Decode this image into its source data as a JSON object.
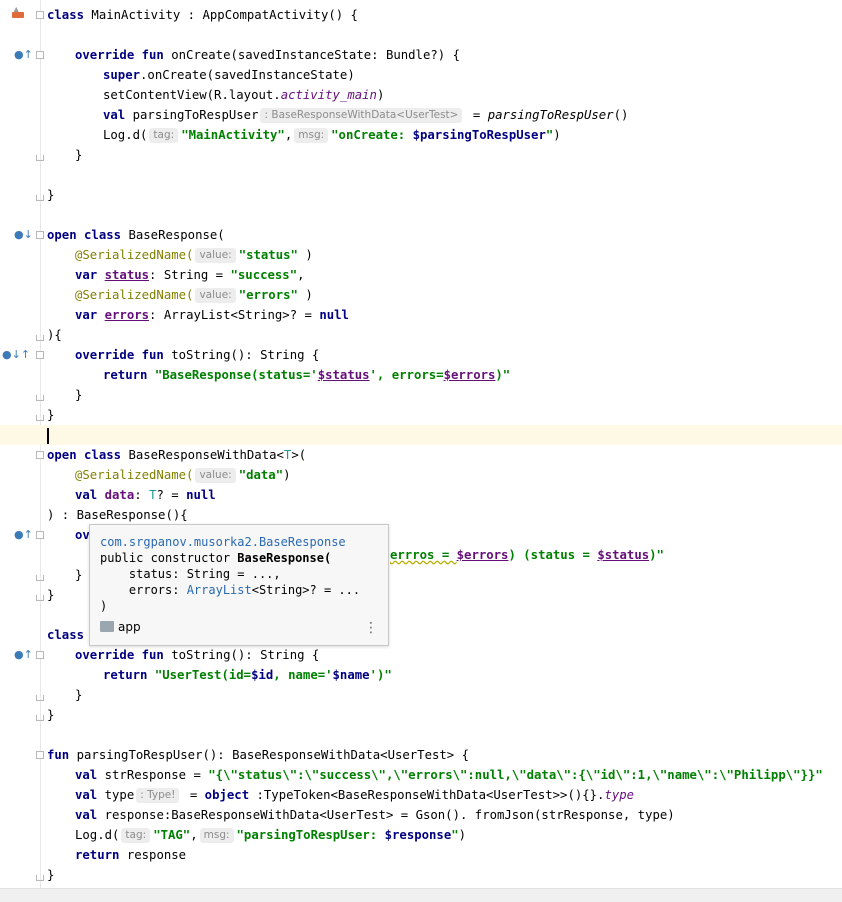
{
  "gutter_icons": {
    "android_activity": "android-activity-icon",
    "override": "override-arrow-icon",
    "implemented": "implemented-down-icon"
  },
  "code": {
    "l1": {
      "kw1": "class",
      "t1": " MainActivity : AppCompatActivity() {"
    },
    "l3": {
      "kw1": "override fun",
      "t1": " onCreate(savedInstanceState: Bundle?) {"
    },
    "l4": {
      "kw1": "super",
      "t1": ".onCreate(savedInstanceState)"
    },
    "l5": {
      "t1": "setContentView(R.layout.",
      "it": "activity_main",
      "t2": ")"
    },
    "l6": {
      "kw1": "val",
      "t1": " parsingToRespUser",
      "hint": ": BaseResponseWithData<UserTest>",
      "t2": " = ",
      "it": "parsingToRespUser",
      "t3": "()"
    },
    "l7": {
      "t1": "Log.d(",
      "h1": "tag:",
      "s1": "\"MainActivity\"",
      "t2": ",",
      "h2": "msg:",
      "s2a": "\"onCreate: ",
      "s2v": "$parsingToRespUser",
      "s2b": "\"",
      "t3": ")"
    },
    "l8": {
      "t1": "}"
    },
    "l10": {
      "t1": "}"
    },
    "l12": {
      "kw1": "open class",
      "t1": " BaseResponse("
    },
    "l13": {
      "a1": "@SerializedName(",
      "h1": "value:",
      "s1": "\"status\"",
      "t1": " )"
    },
    "l14": {
      "kw1": "var",
      "f1": "status",
      "t1": ": String = ",
      "s1": "\"success\"",
      "t2": ","
    },
    "l15": {
      "a1": "@SerializedName(",
      "h1": "value:",
      "s1": "\"errors\"",
      "t1": " )"
    },
    "l16": {
      "kw1": "var",
      "f1": "errors",
      "t1": ": ArrayList<String>? = ",
      "kw2": "null"
    },
    "l17": {
      "t1": "){"
    },
    "l18": {
      "kw1": "override fun",
      "t1": " toString(): String {"
    },
    "l19": {
      "kw1": "return",
      "s1": " \"BaseResponse(status='",
      "v1": "$status",
      "s2": "', errors=",
      "v2": "$errors",
      "s3": ")\""
    },
    "l20": {
      "t1": "}"
    },
    "l21": {
      "t1": "}"
    },
    "l23": {
      "kw1": "open class",
      "t1": " BaseResponseWithData<",
      "tp": "T",
      "t2": ">("
    },
    "l24": {
      "a1": "@SerializedName(",
      "h1": "value:",
      "s1": "\"data\"",
      "t1": ")"
    },
    "l25": {
      "kw1": "val",
      "f1": " data",
      "t1": ": ",
      "tp": "T",
      "t2": "? = ",
      "kw2": "null"
    },
    "l26": {
      "t1": ") : BaseResponse(){"
    },
    "l27": {
      "kw1": "ov",
      "w1": "errros = ",
      "v1": "$errors",
      "s1": ") (status = ",
      "v2": "$status",
      "s2": ")\""
    },
    "l28": {
      "t1": "}"
    },
    "l29": {
      "t1": "}"
    },
    "l31": {
      "kw1": "class"
    },
    "l32": {
      "kw1": "override fun",
      "t1": " toString(): String {"
    },
    "l33": {
      "kw1": "return",
      "s1": " \"UserTest(id=",
      "v1": "$id",
      "s2": ", name='",
      "v2": "$name",
      "s3": "')\""
    },
    "l34": {
      "t1": "}"
    },
    "l35": {
      "t1": "}"
    },
    "l37": {
      "kw1": "fun",
      "t1": " parsingToRespUser(): BaseResponseWithData<UserTest> {"
    },
    "l38": {
      "kw1": "val",
      "t1": " strResponse = ",
      "s1": "\"{\\\"status\\\":\\\"success\\\",\\\"errors\\\":null,\\\"data\\\":{\\\"id\\\":1,\\\"name\\\":\\\"Philipp\\\"}}\""
    },
    "l39": {
      "kw1": "val",
      "t1": " type",
      "hint": ": Type!",
      "t2": " = ",
      "kw2": "object",
      "t3": " :TypeToken<BaseResponseWithData<UserTest>>(){}.",
      "it": "type"
    },
    "l40": {
      "kw1": "val",
      "t1": " response:BaseResponseWithData<UserTest> = Gson(). fromJson(strResponse, type)"
    },
    "l41": {
      "t1": "Log.d(",
      "h1": "tag:",
      "s1": "\"TAG\"",
      "t2": ",",
      "h2": "msg:",
      "s2a": "\"parsingToRespUser: ",
      "s2v": "$response",
      "s2b": "\"",
      "t3": ")"
    },
    "l42": {
      "kw1": "return",
      "t1": " response"
    },
    "l43": {
      "t1": "}"
    }
  },
  "tooltip": {
    "package": "com.srgpanov.musorka2.BaseResponse",
    "sig1": "public constructor ",
    "sig1b": "BaseResponse(",
    "p1": "    status: String = ...,",
    "p2a": "    errors: ",
    "p2t": "ArrayList",
    "p2b": "<String>? = ...",
    "close": ")",
    "module": "app",
    "more": "⋮"
  }
}
